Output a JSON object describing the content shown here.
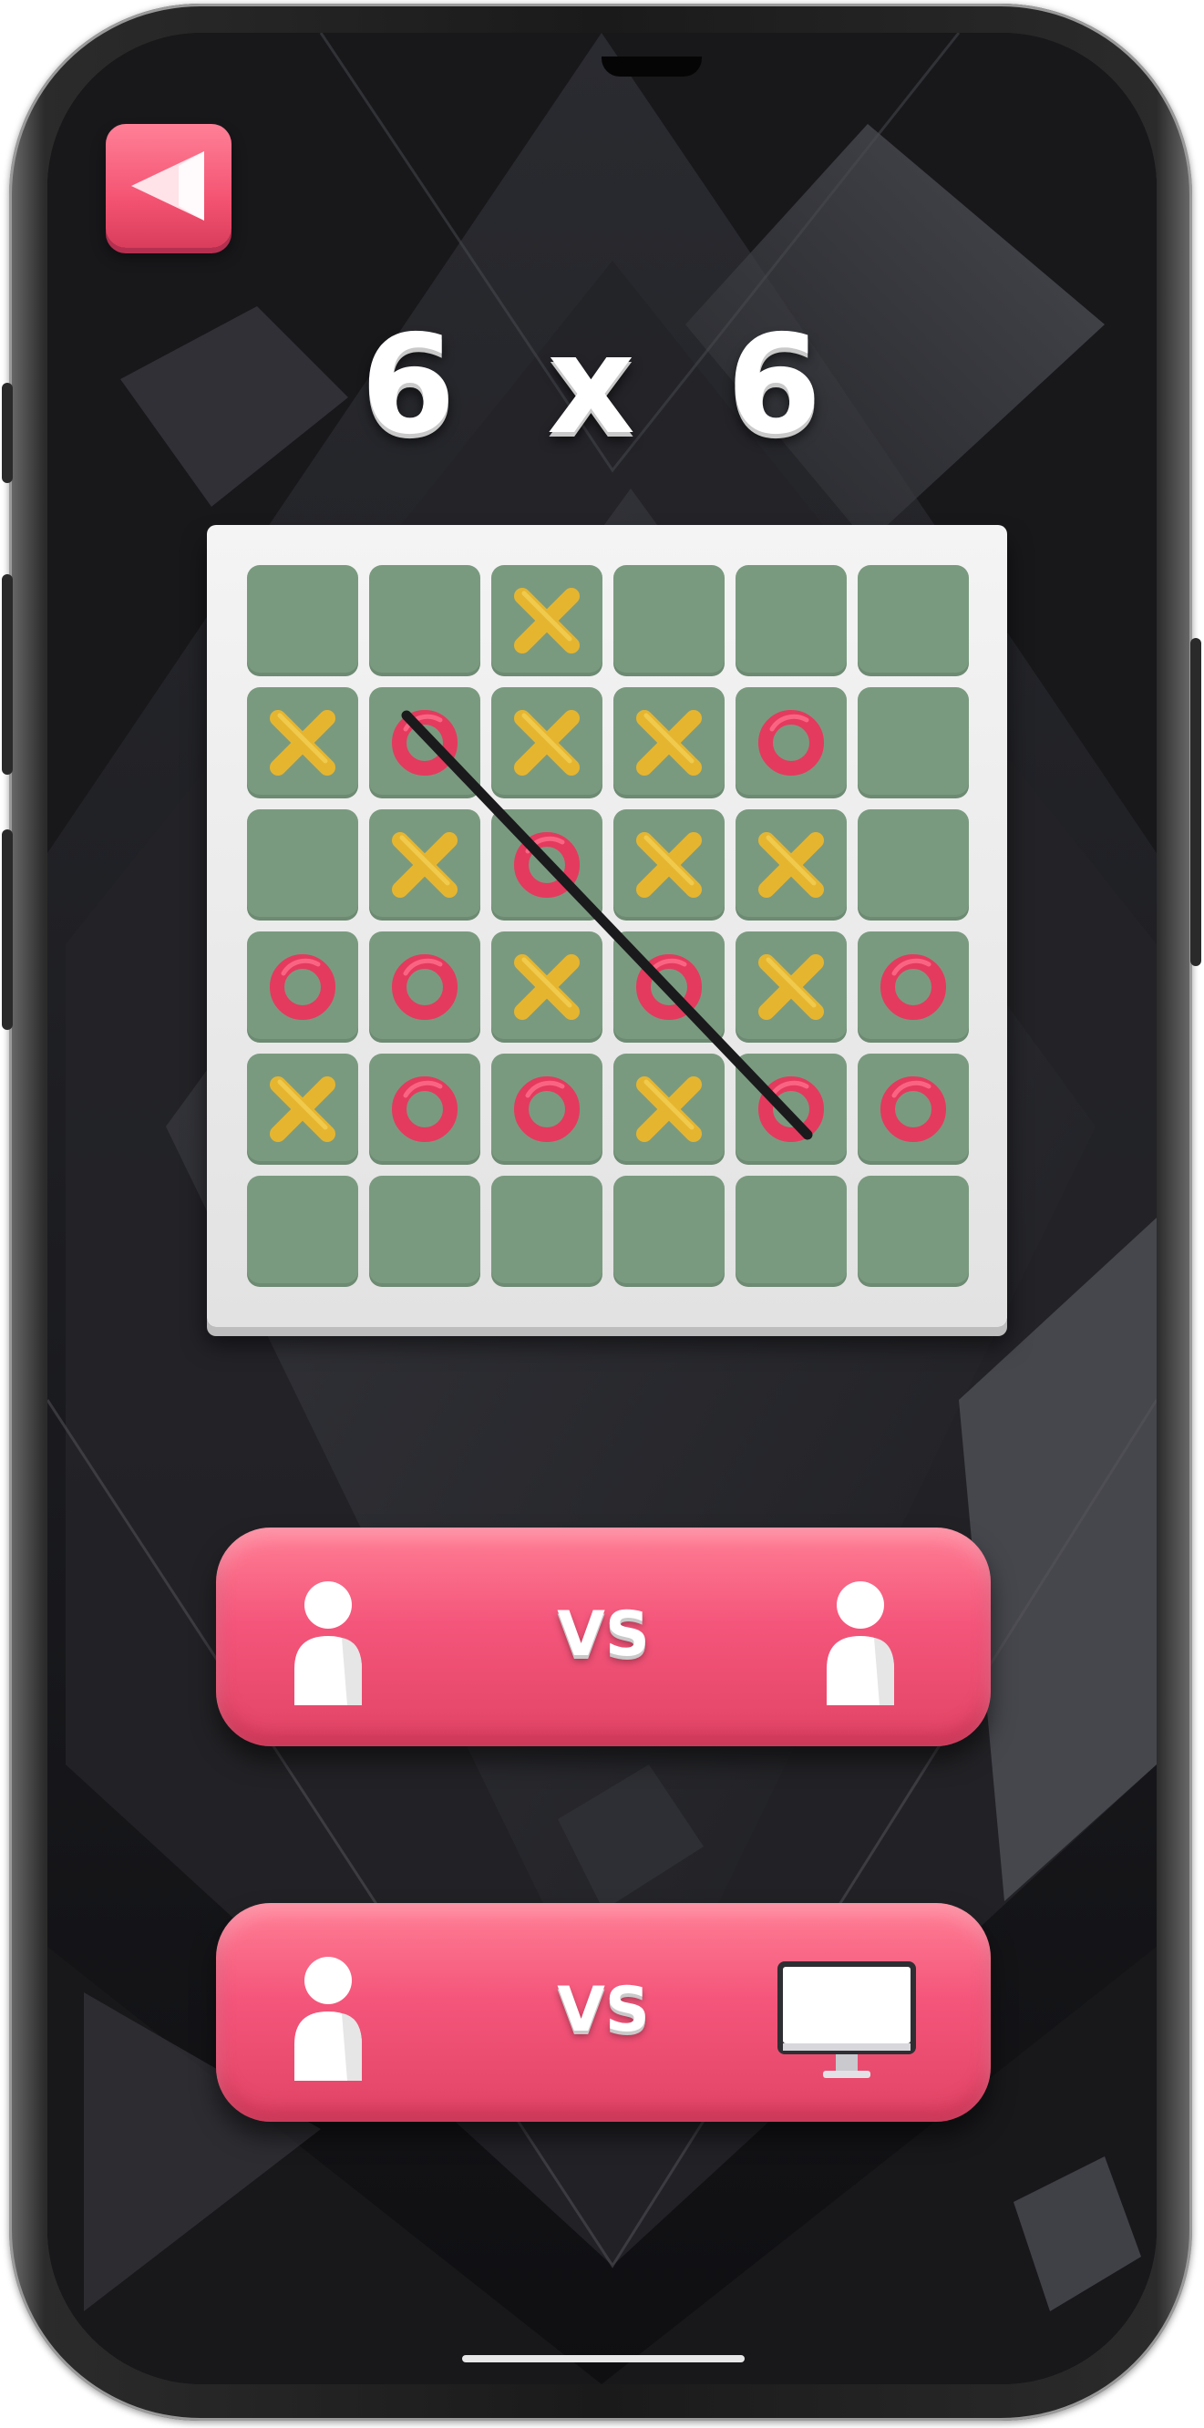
{
  "title": "6 x 6",
  "back_button": {
    "icon": "back-triangle-icon"
  },
  "board": {
    "size": 6,
    "cells": [
      [
        "",
        "",
        "X",
        "",
        "",
        ""
      ],
      [
        "X",
        "O",
        "X",
        "X",
        "O",
        ""
      ],
      [
        "",
        "X",
        "O",
        "X",
        "X",
        ""
      ],
      [
        "O",
        "O",
        "X",
        "O",
        "X",
        "O"
      ],
      [
        "X",
        "O",
        "O",
        "X",
        "O",
        "O"
      ],
      [
        "",
        "",
        "",
        "",
        "",
        ""
      ]
    ],
    "winning_line": {
      "from": [
        1,
        1
      ],
      "to": [
        4,
        4
      ],
      "mark": "O"
    }
  },
  "modes": [
    {
      "label": "VS",
      "left_icon": "player-icon",
      "right_icon": "player-icon"
    },
    {
      "label": "VS",
      "left_icon": "player-icon",
      "right_icon": "computer-icon"
    }
  ],
  "colors": {
    "accent": "#f4557a",
    "cell": "#7a9a7f",
    "x_mark": "#e6b52f",
    "o_mark": "#e43a5e"
  }
}
